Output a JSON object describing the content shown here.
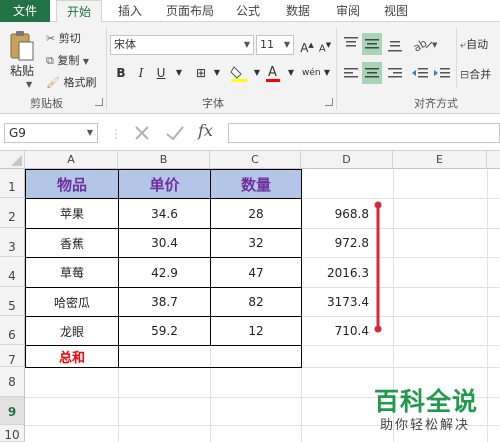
{
  "tabs": [
    {
      "label": "文件"
    },
    {
      "label": "开始"
    },
    {
      "label": "插入"
    },
    {
      "label": "页面布局"
    },
    {
      "label": "公式"
    },
    {
      "label": "数据"
    },
    {
      "label": "审阅"
    },
    {
      "label": "视图"
    }
  ],
  "ribbon": {
    "clipboard": {
      "paste": "粘贴",
      "cut": "剪切",
      "copy": "复制",
      "format_painter": "格式刷",
      "label": "剪贴板"
    },
    "font": {
      "name": "宋体",
      "size": "11",
      "bold": "B",
      "italic": "I",
      "underline": "U",
      "label": "字体"
    },
    "alignment": {
      "wrap": "自动",
      "merge": "合并",
      "label": "对齐方式"
    }
  },
  "formula_bar": {
    "name_box": "G9",
    "fx": "fx"
  },
  "columns": [
    "A",
    "B",
    "C",
    "D",
    "E"
  ],
  "rows": [
    "1",
    "2",
    "3",
    "4",
    "5",
    "6",
    "7",
    "8",
    "9",
    "10"
  ],
  "table": {
    "headers": [
      "物品",
      "单价",
      "数量"
    ],
    "rows": [
      {
        "item": "苹果",
        "price": "34.6",
        "qty": "28",
        "total": "968.8"
      },
      {
        "item": "香蕉",
        "price": "30.4",
        "qty": "32",
        "total": "972.8"
      },
      {
        "item": "草莓",
        "price": "42.9",
        "qty": "47",
        "total": "2016.3"
      },
      {
        "item": "哈密瓜",
        "price": "38.7",
        "qty": "82",
        "total": "3173.4"
      },
      {
        "item": "龙眼",
        "price": "59.2",
        "qty": "12",
        "total": "710.4"
      }
    ],
    "sum_label": "总和"
  },
  "watermark": {
    "title": "百科全说",
    "subtitle": "助你轻松解决"
  },
  "colors": {
    "accent": "#217346",
    "header_fill": "#b4c6e7",
    "header_text": "#7030a0",
    "sum_text": "#ff0000",
    "annotation": "#d9263a"
  }
}
